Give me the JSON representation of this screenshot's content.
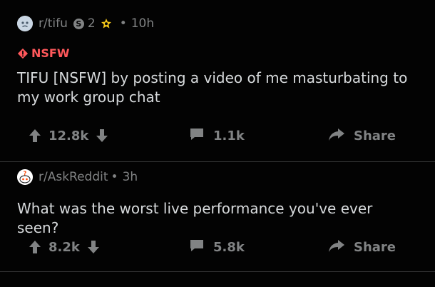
{
  "posts": [
    {
      "subreddit": "r/tifu",
      "coin_count": "2",
      "coin_symbol": "S",
      "time": "10h",
      "nsfw_label": "NSFW",
      "title": "TIFU [NSFW] by posting a video of me masturbating to my work group chat",
      "score": "12.8k",
      "comments": "1.1k",
      "share_label": "Share"
    },
    {
      "subreddit": "r/AskReddit",
      "time": "3h",
      "title": "What was the worst live performance you've ever seen?",
      "score": "8.2k",
      "comments": "5.8k",
      "share_label": "Share"
    }
  ],
  "icons": {
    "upvote": "upvote-icon",
    "downvote": "downvote-icon",
    "comment": "comment-icon",
    "share": "share-icon",
    "nsfw": "nsfw-warning-icon",
    "award": "award-icon"
  },
  "colors": {
    "background": "#030303",
    "text": "#d7dadc",
    "muted": "#818384",
    "nsfw": "#ff585b",
    "award": "#f0c419",
    "divider": "#343536"
  }
}
